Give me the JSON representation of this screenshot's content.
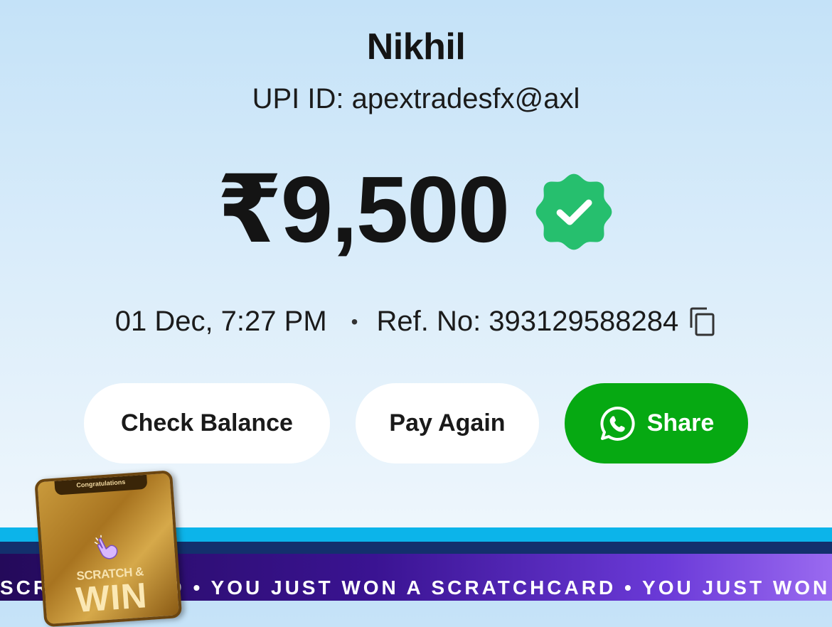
{
  "payee": {
    "name": "Nikhil",
    "upi_line": "UPI ID: apextradesfx@axl"
  },
  "payment": {
    "amount": "₹9,500",
    "status_icon": "verified-check-badge-icon",
    "datetime": "01 Dec, 7:27 PM",
    "separator": "•",
    "reference": "Ref. No: 393129588284",
    "copy_icon": "copy-icon"
  },
  "actions": {
    "check_balance": "Check Balance",
    "pay_again": "Pay Again",
    "share": "Share",
    "share_icon": "whatsapp-icon"
  },
  "promo": {
    "marquee_text": "SCRATCHCARD  •  YOU JUST WON A SCRATCHCARD  •  YOU JUST WON A SCRATCHCARD",
    "card_title": "Congratulations",
    "card_scratch": "SCRATCH &",
    "card_win": "WIN"
  },
  "colors": {
    "verified_green": "#26bf6e",
    "share_green": "#06a912",
    "stripe_cyan": "#0cb4ea",
    "stripe_navy": "#13306d",
    "banner_purple": "#3a1392"
  }
}
